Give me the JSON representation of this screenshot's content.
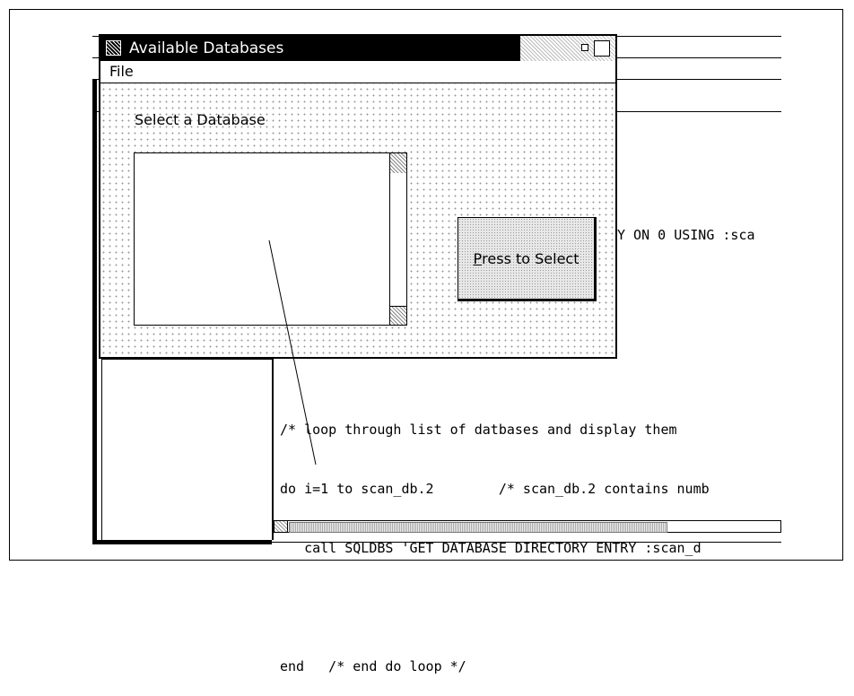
{
  "dialog": {
    "title": "Available Databases",
    "menu": [
      "File"
    ],
    "select_label": "Select a Database",
    "button": {
      "mnemonic": "P",
      "rest": "ress to Select"
    }
  },
  "editor": {
    "partial_line": "Y ON 0 USING :sca",
    "code_lines": [
      "/* loop through list of datbases and display them",
      "do i=1 to scan_db.2        /* scan_db.2 contains numb",
      "   call SQLDBS 'GET DATABASE DIRECTORY ENTRY :scan_d",
      "",
      "end   /* end do loop */"
    ]
  }
}
